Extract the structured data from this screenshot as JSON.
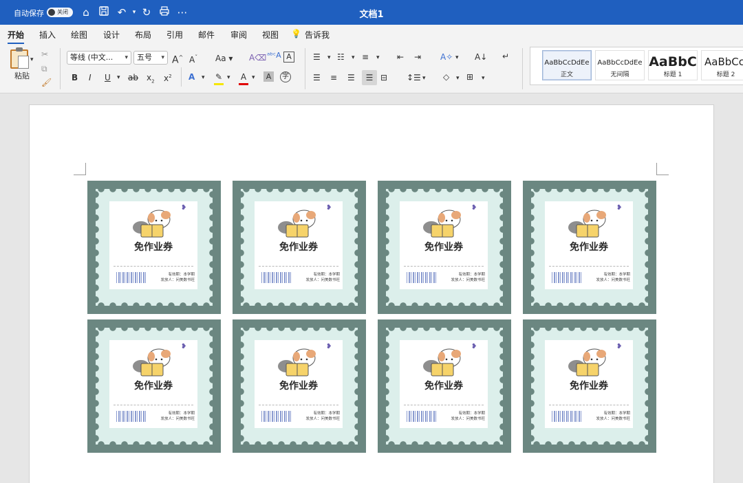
{
  "titlebar": {
    "autosave_label": "自动保存",
    "toggle_label": "关闭",
    "document_title": "文档1",
    "icons": [
      "home-icon",
      "save-icon",
      "undo-icon",
      "redo-icon",
      "print-icon",
      "more-icon"
    ]
  },
  "tabs": [
    "开始",
    "插入",
    "绘图",
    "设计",
    "布局",
    "引用",
    "邮件",
    "审阅",
    "视图",
    "告诉我"
  ],
  "ribbon": {
    "paste_label": "粘贴",
    "font_name": "等线 (中文...",
    "font_size": "五号",
    "change_case": "Aa",
    "styles": [
      {
        "preview": "AaBbCcDdEe",
        "name": "正文"
      },
      {
        "preview": "AaBbCcDdEe",
        "name": "无间隔"
      },
      {
        "preview": "AaBbC",
        "name": "标题 1"
      },
      {
        "preview": "AaBbCcD",
        "name": "标题 2"
      }
    ]
  },
  "coupons": [
    {
      "title": "免作业券",
      "issuer_line1": "有效期：本学期",
      "issuer_line2": "发放人：问美数书旺"
    },
    {
      "title": "免作业券",
      "issuer_line1": "有效期：本学期",
      "issuer_line2": "发放人：问美数书旺"
    },
    {
      "title": "免作业券",
      "issuer_line1": "有效期：本学期",
      "issuer_line2": "发放人：问美数书旺"
    },
    {
      "title": "免作业券",
      "issuer_line1": "有效期：本学期",
      "issuer_line2": "发放人：问美数书旺"
    },
    {
      "title": "免作业券",
      "issuer_line1": "有效期：本学期",
      "issuer_line2": "发放人：问美数书旺"
    },
    {
      "title": "免作业券",
      "issuer_line1": "有效期：本学期",
      "issuer_line2": "发放人：问美数书旺"
    },
    {
      "title": "免作业券",
      "issuer_line1": "有效期：本学期",
      "issuer_line2": "发放人：问美数书旺"
    },
    {
      "title": "免作业券",
      "issuer_line1": "有效期：本学期",
      "issuer_line2": "发放人：问美数书旺"
    }
  ],
  "colors": {
    "titlebar": "#1f5fbf",
    "stamp_frame": "#6b8781",
    "stamp_bg": "#dcefeb",
    "barcode": "#8a9bd0"
  }
}
